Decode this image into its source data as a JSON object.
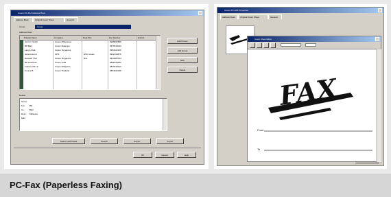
{
  "caption": "PC-Fax (Paperless Faxing)",
  "left_window": {
    "title": "Canon PC-FAX Address Book",
    "tabs": [
      "Address Book",
      "Original Cover Sheet",
      "General"
    ],
    "group_label": "Group",
    "group_value": "Group",
    "address_book_label": "Address Book",
    "columns": [
      "Display Name",
      "Company",
      "Dept./Div.",
      "Fax Number",
      "Entries"
    ],
    "rows": [
      [
        "John D. Smith",
        "Canon Philippines",
        "",
        "0998897880",
        ""
      ],
      [
        "Bill Blair",
        "Canon Malaysia",
        "",
        "0976543219",
        ""
      ],
      [
        "Lang LCHE",
        "Canon Singapore",
        "",
        "0954322109",
        ""
      ],
      [
        "Jessica Lund",
        "OPS",
        "ESC Issues",
        "0932109876",
        ""
      ],
      [
        "Hamesh Thor",
        "Canon Singapore",
        "R/G",
        "0910987654",
        ""
      ],
      [
        "Bill Gosworth",
        "Canon India",
        "",
        "0898765432",
        ""
      ],
      [
        "Frank LOW Lin",
        "Canon Philippine",
        "",
        "0876543210",
        ""
      ],
      [
        "Connie B.",
        "Canon Thailand",
        "",
        "0854321098",
        ""
      ]
    ],
    "side_buttons": [
      "Add Person",
      "Add Group",
      "Edit",
      "Delete"
    ],
    "detail_label": "Details",
    "details": [
      {
        "label": "Name:",
        "value": ""
      },
      {
        "label": "Fax:",
        "value": "Bill"
      },
      {
        "label": "Co.:",
        "value": "Blair"
      },
      {
        "label": "Dept.:",
        "value": "Malaysia"
      },
      {
        "label": "Mail:",
        "value": ""
      }
    ],
    "bottom_buttons": [
      "Search with Fields",
      "Search",
      "Export",
      "Import"
    ],
    "dialog_buttons": [
      "OK",
      "Cancel",
      "Help"
    ]
  },
  "right_window": {
    "back_title": "Canon PC-FAX Properties",
    "back_tabs": [
      "Address Book",
      "Original Cover Sheet",
      "General"
    ],
    "front_title": "Cover Sheet Editor",
    "fax_word": "FAX",
    "field_labels": [
      "From",
      "To"
    ],
    "close_button": "Close"
  },
  "colors": {
    "title_bar": "#0a246a",
    "window_face": "#d4d0c8",
    "caption_bar": "#d6d6d6"
  }
}
